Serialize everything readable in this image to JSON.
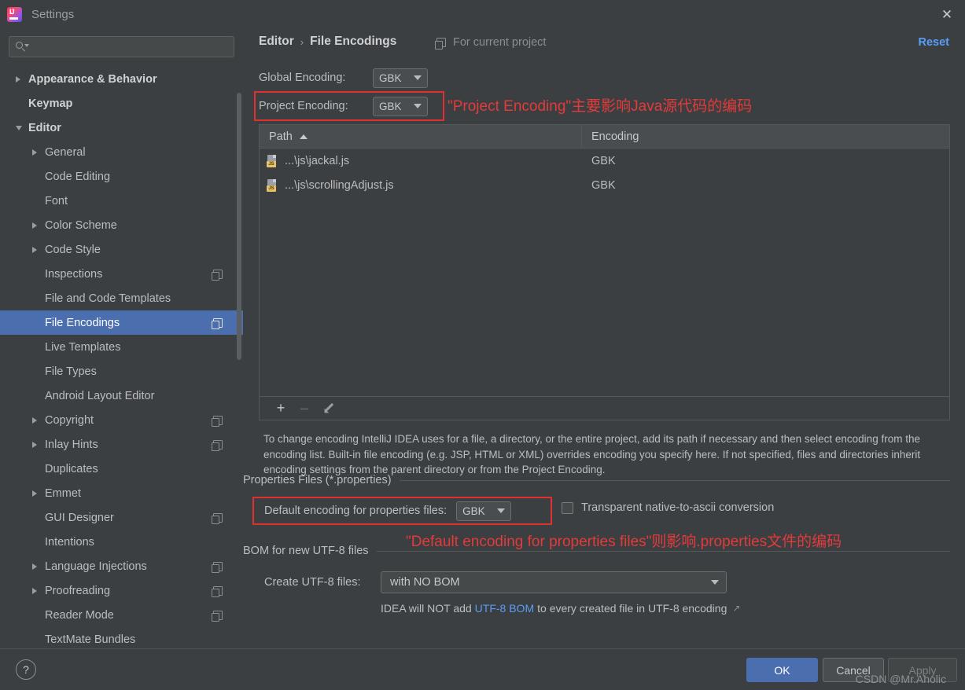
{
  "window": {
    "title": "Settings",
    "close_label": "✕",
    "logo_name": "intellij-idea-logo"
  },
  "search": {
    "value": "",
    "placeholder": ""
  },
  "sidebar": {
    "items": [
      {
        "label": "Appearance & Behavior",
        "level": 1,
        "arrow": "closed",
        "bold": true,
        "selected": false,
        "project_icon": false
      },
      {
        "label": "Keymap",
        "level": 1,
        "arrow": "none",
        "bold": true,
        "selected": false,
        "project_icon": false
      },
      {
        "label": "Editor",
        "level": 1,
        "arrow": "open",
        "bold": true,
        "selected": false,
        "project_icon": false
      },
      {
        "label": "General",
        "level": 2,
        "arrow": "closed",
        "bold": false,
        "selected": false,
        "project_icon": false
      },
      {
        "label": "Code Editing",
        "level": 2,
        "arrow": "none",
        "bold": false,
        "selected": false,
        "project_icon": false
      },
      {
        "label": "Font",
        "level": 2,
        "arrow": "none",
        "bold": false,
        "selected": false,
        "project_icon": false
      },
      {
        "label": "Color Scheme",
        "level": 2,
        "arrow": "closed",
        "bold": false,
        "selected": false,
        "project_icon": false
      },
      {
        "label": "Code Style",
        "level": 2,
        "arrow": "closed",
        "bold": false,
        "selected": false,
        "project_icon": false
      },
      {
        "label": "Inspections",
        "level": 2,
        "arrow": "none",
        "bold": false,
        "selected": false,
        "project_icon": true
      },
      {
        "label": "File and Code Templates",
        "level": 2,
        "arrow": "none",
        "bold": false,
        "selected": false,
        "project_icon": false
      },
      {
        "label": "File Encodings",
        "level": 2,
        "arrow": "none",
        "bold": false,
        "selected": true,
        "project_icon": true
      },
      {
        "label": "Live Templates",
        "level": 2,
        "arrow": "none",
        "bold": false,
        "selected": false,
        "project_icon": false
      },
      {
        "label": "File Types",
        "level": 2,
        "arrow": "none",
        "bold": false,
        "selected": false,
        "project_icon": false
      },
      {
        "label": "Android Layout Editor",
        "level": 2,
        "arrow": "none",
        "bold": false,
        "selected": false,
        "project_icon": false
      },
      {
        "label": "Copyright",
        "level": 2,
        "arrow": "closed",
        "bold": false,
        "selected": false,
        "project_icon": true
      },
      {
        "label": "Inlay Hints",
        "level": 2,
        "arrow": "closed",
        "bold": false,
        "selected": false,
        "project_icon": true
      },
      {
        "label": "Duplicates",
        "level": 2,
        "arrow": "none",
        "bold": false,
        "selected": false,
        "project_icon": false
      },
      {
        "label": "Emmet",
        "level": 2,
        "arrow": "closed",
        "bold": false,
        "selected": false,
        "project_icon": false
      },
      {
        "label": "GUI Designer",
        "level": 2,
        "arrow": "none",
        "bold": false,
        "selected": false,
        "project_icon": true
      },
      {
        "label": "Intentions",
        "level": 2,
        "arrow": "none",
        "bold": false,
        "selected": false,
        "project_icon": false
      },
      {
        "label": "Language Injections",
        "level": 2,
        "arrow": "closed",
        "bold": false,
        "selected": false,
        "project_icon": true
      },
      {
        "label": "Proofreading",
        "level": 2,
        "arrow": "closed",
        "bold": false,
        "selected": false,
        "project_icon": true
      },
      {
        "label": "Reader Mode",
        "level": 2,
        "arrow": "none",
        "bold": false,
        "selected": false,
        "project_icon": true
      },
      {
        "label": "TextMate Bundles",
        "level": 2,
        "arrow": "none",
        "bold": false,
        "selected": false,
        "project_icon": false
      }
    ]
  },
  "header": {
    "breadcrumb_parent": "Editor",
    "breadcrumb_separator": "›",
    "breadcrumb_current": "File Encodings",
    "for_current_project": "For current project",
    "reset_label": "Reset"
  },
  "encodings": {
    "global_label": "Global Encoding:",
    "global_value": "GBK",
    "project_label": "Project Encoding:",
    "project_value": "GBK"
  },
  "table": {
    "columns": [
      "Path",
      "Encoding"
    ],
    "sort_column": "Path",
    "sort_direction": "ascending",
    "rows": [
      {
        "path": "...\\js\\jackal.js",
        "encoding": "GBK",
        "icon": "js-file-icon"
      },
      {
        "path": "...\\js\\scrollingAdjust.js",
        "encoding": "GBK",
        "icon": "js-file-icon"
      }
    ]
  },
  "table_toolbar": {
    "add_label": "+",
    "remove_label": "–",
    "edit_label": "edit"
  },
  "help_text": "To change encoding IntelliJ IDEA uses for a file, a directory, or the entire project, add its path if necessary and then select encoding from the encoding list. Built-in file encoding (e.g. JSP, HTML or XML) overrides encoding you specify here. If not specified, files and directories inherit encoding settings from the parent directory or from the Project Encoding.",
  "properties_section": {
    "title": "Properties Files (*.properties)",
    "default_encoding_label": "Default encoding for properties files:",
    "default_encoding_value": "GBK",
    "checkbox_label": "Transparent native-to-ascii conversion",
    "checkbox_checked": false
  },
  "bom_section": {
    "title": "BOM for new UTF-8 files",
    "create_label": "Create UTF-8 files:",
    "create_value": "with NO BOM",
    "hint_prefix": "IDEA will NOT add",
    "hint_link": "UTF-8 BOM",
    "hint_suffix": "to every created file in UTF-8 encoding",
    "external_link_glyph": "↗"
  },
  "annotations": {
    "note1": "\"Project Encoding\"主要影响Java源代码的编码",
    "note2": "\"Default encoding for properties files\"则影响.properties文件的编码",
    "highlight_color": "#e03030",
    "text_color": "#e33a3a"
  },
  "footer": {
    "help_label": "?",
    "ok_label": "OK",
    "cancel_label": "Cancel",
    "apply_label": "Apply",
    "watermark": "CSDN @Mr.Aholic"
  },
  "colors": {
    "accent": "#4b6eaf",
    "link": "#589df6",
    "background": "#3c3f41"
  }
}
